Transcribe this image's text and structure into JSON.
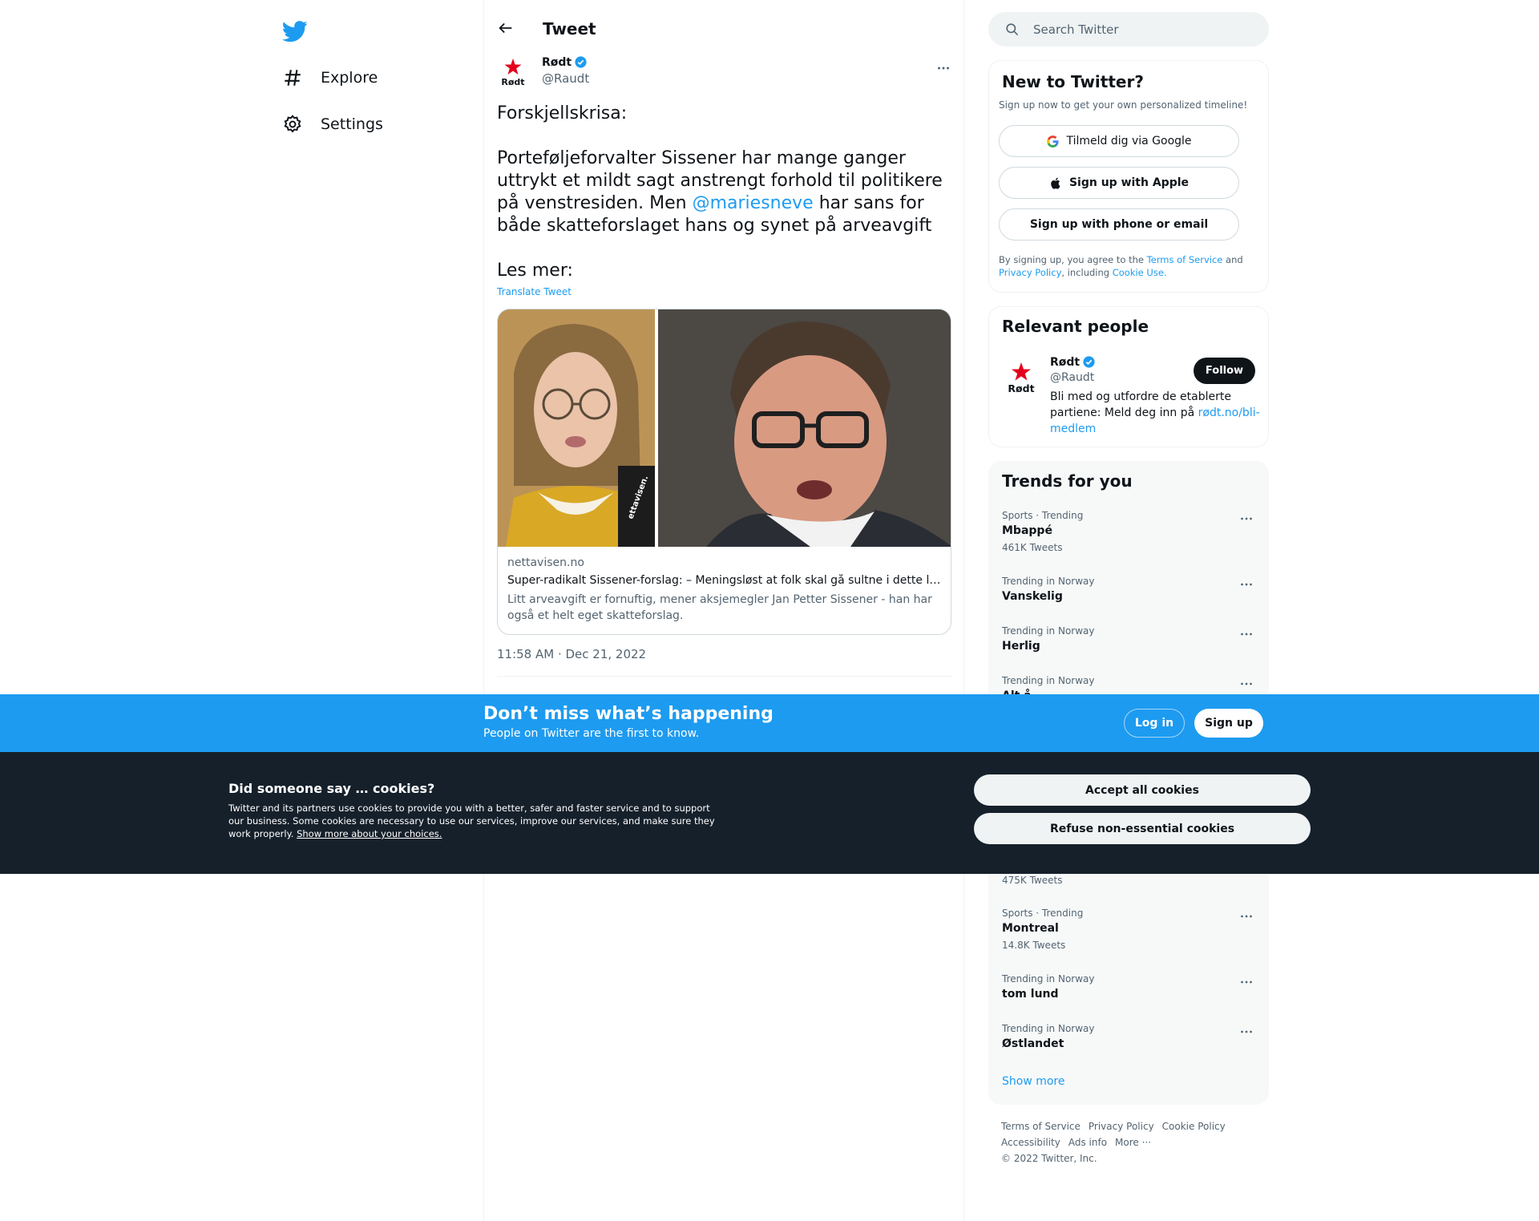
{
  "nav": {
    "items": [
      {
        "label": "Explore",
        "icon": "hashtag-icon"
      },
      {
        "label": "Settings",
        "icon": "gear-icon"
      }
    ]
  },
  "header": {
    "title": "Tweet"
  },
  "tweet": {
    "author": {
      "name": "Rødt",
      "handle": "@Raudt",
      "avatar_text": "Rødt"
    },
    "text_before": "Forskjellskrisa:\n\nPorteføljeforvalter Sissener har mange ganger uttrykt et mildt sagt anstrengt forhold til politikere på venstresiden. Men ",
    "mention": "@mariesneve",
    "text_after": " har sans for både skatteforslaget hans og synet på arveavgift\n\nLes mer:",
    "translate": "Translate Tweet",
    "card": {
      "domain": "nettavisen.no",
      "title": "Super-radikalt Sissener-forslag: – Meningsløst at folk skal gå sultne i dette landet",
      "description": "Litt arveavgift er fornuftig, mener aksjemegler Jan Petter Sissener - han har også et helt eget skatteforslag.",
      "image_watermark": "ettavisen."
    },
    "timestamp": "11:58 AM · Dec 21, 2022"
  },
  "search": {
    "placeholder": "Search Twitter"
  },
  "signup": {
    "title": "New to Twitter?",
    "subtitle": "Sign up now to get your own personalized timeline!",
    "google_label": "Tilmeld dig via Google",
    "apple_label": "Sign up with Apple",
    "phone_label": "Sign up with phone or email",
    "legal_1": "By signing up, you agree to the ",
    "terms": "Terms of Service",
    "legal_2": " and ",
    "privacy": "Privacy Policy",
    "legal_3": ", including ",
    "cookie_use": "Cookie Use."
  },
  "people": {
    "title": "Relevant people",
    "name": "Rødt",
    "handle": "@Raudt",
    "follow_label": "Follow",
    "bio": "Bli med og utfordre de etablerte partiene: Meld deg inn på ",
    "bio_link": "rødt.no/bli-medlem"
  },
  "trends": {
    "title": "Trends for you",
    "items": [
      {
        "meta": "Sports · Trending",
        "name": "Mbappé",
        "count": "461K Tweets"
      },
      {
        "meta": "Trending in Norway",
        "name": "Vanskelig",
        "count": ""
      },
      {
        "meta": "Trending in Norway",
        "name": "Herlig",
        "count": ""
      },
      {
        "meta": "Trending in Norway",
        "name": "Alt å",
        "count": ""
      },
      {
        "meta": "",
        "name": "",
        "count": "475K Tweets"
      },
      {
        "meta": "Sports · Trending",
        "name": "Montreal",
        "count": "14.8K Tweets"
      },
      {
        "meta": "Trending in Norway",
        "name": "tom lund",
        "count": ""
      },
      {
        "meta": "Trending in Norway",
        "name": "Østlandet",
        "count": ""
      }
    ],
    "show_more": "Show more"
  },
  "footer": {
    "links": [
      "Terms of Service",
      "Privacy Policy",
      "Cookie Policy",
      "Accessibility",
      "Ads info",
      "More ···"
    ],
    "copyright": "© 2022 Twitter, Inc."
  },
  "bottom_bar": {
    "title": "Don’t miss what’s happening",
    "subtitle": "People on Twitter are the first to know.",
    "login_label": "Log in",
    "signup_label": "Sign up"
  },
  "cookies": {
    "title": "Did someone say … cookies?",
    "text": "Twitter and its partners use cookies to provide you with a better, safer and faster service and to support our business. Some cookies are necessary to use our services, improve our services, and make sure they work properly. ",
    "link": "Show more about your choices.",
    "accept_label": "Accept all cookies",
    "refuse_label": "Refuse non-essential cookies"
  },
  "colors": {
    "brand": "#1d9bf0",
    "text": "#0f1419",
    "secondary": "#536471",
    "cookie_bg": "#15202b",
    "party_red": "#e3001b"
  }
}
